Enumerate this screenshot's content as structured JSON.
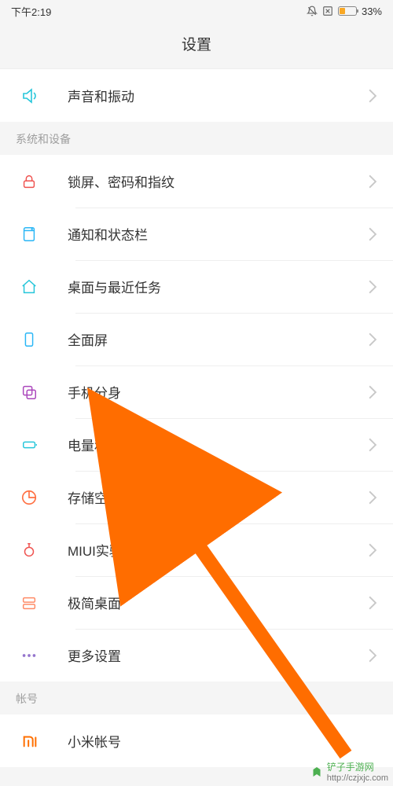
{
  "status": {
    "time": "下午2:19",
    "battery_pct": "33%"
  },
  "header": {
    "title": "设置"
  },
  "top_item": {
    "label": "声音和振动"
  },
  "section1": {
    "title": "系统和设备",
    "items": [
      {
        "label": "锁屏、密码和指纹"
      },
      {
        "label": "通知和状态栏"
      },
      {
        "label": "桌面与最近任务"
      },
      {
        "label": "全面屏"
      },
      {
        "label": "手机分身"
      },
      {
        "label": "电量和性能"
      },
      {
        "label": "存储空间"
      },
      {
        "label": "MIUI实验室"
      },
      {
        "label": "极简桌面"
      },
      {
        "label": "更多设置"
      }
    ]
  },
  "section2": {
    "title": "帐号",
    "items": [
      {
        "label": "小米帐号"
      }
    ]
  },
  "watermark": {
    "text": "铲子手游网",
    "url": "http://czjxjc.com"
  }
}
